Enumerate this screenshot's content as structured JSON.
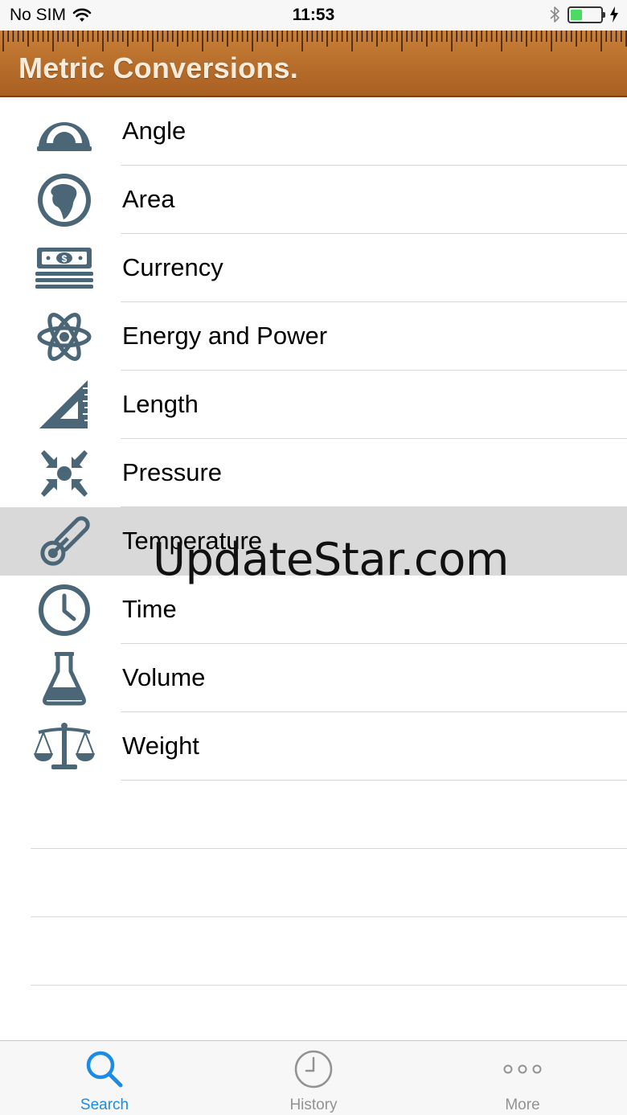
{
  "status_bar": {
    "carrier": "No SIM",
    "time": "11:53",
    "battery_percent": 40
  },
  "header": {
    "title": "Metric Conversions."
  },
  "list": {
    "items": [
      {
        "label": "Angle",
        "icon": "angle-gauge-icon"
      },
      {
        "label": "Area",
        "icon": "globe-icon"
      },
      {
        "label": "Currency",
        "icon": "money-stack-icon"
      },
      {
        "label": "Energy and Power",
        "icon": "atom-icon"
      },
      {
        "label": "Length",
        "icon": "set-square-icon"
      },
      {
        "label": "Pressure",
        "icon": "compress-arrows-icon"
      },
      {
        "label": "Temperature",
        "icon": "thermometer-icon",
        "selected": true
      },
      {
        "label": "Time",
        "icon": "clock-icon"
      },
      {
        "label": "Volume",
        "icon": "flask-icon"
      },
      {
        "label": "Weight",
        "icon": "balance-scale-icon"
      }
    ]
  },
  "watermark": "UpdateStar.com",
  "tabbar": {
    "tabs": [
      {
        "label": "Search",
        "icon": "search-icon",
        "active": true
      },
      {
        "label": "History",
        "icon": "clock-icon",
        "active": false
      },
      {
        "label": "More",
        "icon": "more-dots-icon",
        "active": false
      }
    ]
  },
  "colors": {
    "icon": "#4a6677",
    "active_tab": "#1a8be6",
    "inactive_tab": "#929292",
    "header_wood": "#b9702c",
    "selected_row": "#d9d9d9"
  }
}
